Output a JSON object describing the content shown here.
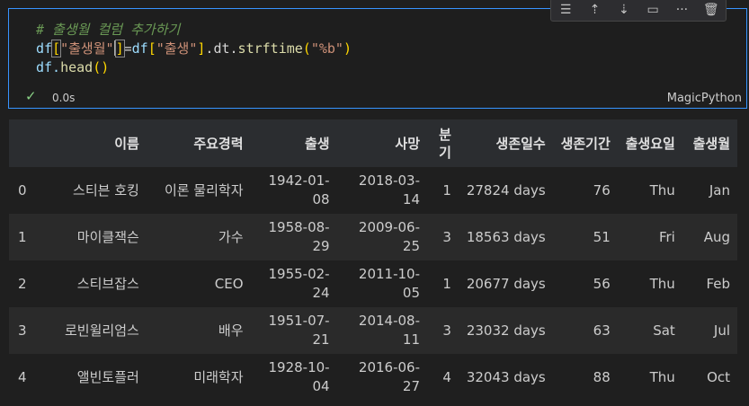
{
  "code": {
    "comment": "# 출생월 컬럼 추가하기",
    "line2": {
      "df1": "df",
      "key1": "\"출생월\"",
      "df2": "df",
      "key2": "\"출생\"",
      "attr": ".dt.",
      "fn": "strftime",
      "arg": "\"%b\""
    },
    "line3": {
      "df": "df.",
      "fn": "head",
      "parens": "()"
    }
  },
  "status": {
    "check": "✓",
    "time": "0.0s",
    "language": "MagicPython"
  },
  "toolbar": {
    "icons": [
      "format-icon",
      "run-above-icon",
      "run-below-icon",
      "split-icon",
      "more-icon",
      "delete-icon"
    ],
    "more": "···"
  },
  "table": {
    "headers": [
      "",
      "이름",
      "주요경력",
      "출생",
      "사망",
      "분기",
      "생존일수",
      "생존기간",
      "출생요일",
      "출생월"
    ],
    "rows": [
      [
        "0",
        "스티븐 호킹",
        "이론 물리학자",
        "1942-01-08",
        "2018-03-14",
        "1",
        "27824 days",
        "76",
        "Thu",
        "Jan"
      ],
      [
        "1",
        "마이클잭슨",
        "가수",
        "1958-08-29",
        "2009-06-25",
        "3",
        "18563 days",
        "51",
        "Fri",
        "Aug"
      ],
      [
        "2",
        "스티브잡스",
        "CEO",
        "1955-02-24",
        "2011-10-05",
        "1",
        "20677 days",
        "56",
        "Thu",
        "Feb"
      ],
      [
        "3",
        "로빈윌리엄스",
        "배우",
        "1951-07-21",
        "2014-08-11",
        "3",
        "23032 days",
        "63",
        "Sat",
        "Jul"
      ],
      [
        "4",
        "앨빈토플러",
        "미래학자",
        "1928-10-04",
        "2016-06-27",
        "4",
        "32043 days",
        "88",
        "Thu",
        "Oct"
      ]
    ]
  }
}
